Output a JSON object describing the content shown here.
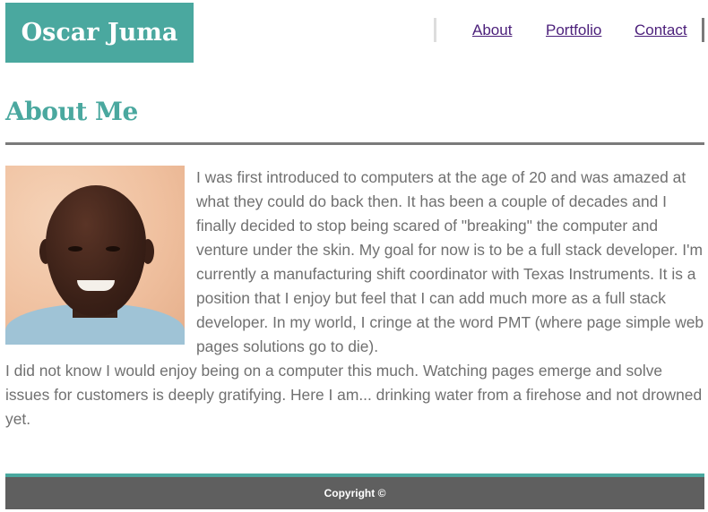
{
  "header": {
    "logo_text": "Oscar Juma",
    "nav": [
      {
        "label": "About"
      },
      {
        "label": "Portfolio"
      },
      {
        "label": "Contact"
      }
    ]
  },
  "main": {
    "title": "About Me",
    "paragraph_1": "I was first introduced to computers at the age of 20 and was amazed at what they could do back then. It has been a couple of decades and I finally decided to stop being scared of \"breaking\" the computer and venture under the skin. My goal for now is to be a full stack developer. I'm currently a manufacturing shift coordinator with Texas Instruments. It is a position that I enjoy but feel that I can add much more as a full stack developer. In my world, I cringe at the word PMT (where page simple web pages solutions go to die).",
    "paragraph_2": "I did not know I would enjoy being on a computer this much. Watching pages emerge and solve issues for customers is deeply gratifying. Here I am... drinking water from a firehose and not drowned yet."
  },
  "footer": {
    "copyright": "Copyright ©"
  },
  "colors": {
    "accent": "#4aa89f",
    "text": "#707070",
    "footer_bg": "#5f5f5f",
    "link": "#4b1f7a"
  }
}
